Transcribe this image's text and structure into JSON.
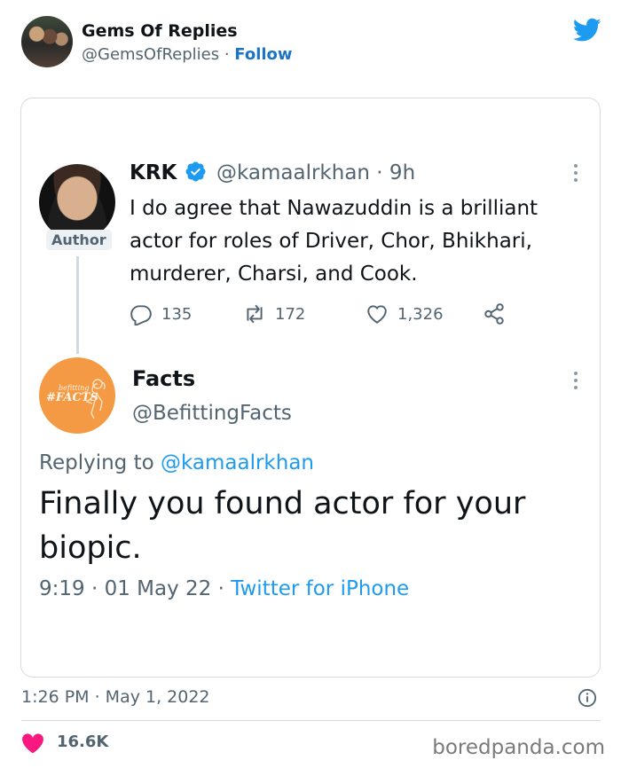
{
  "embed": {
    "author_name": "Gems Of Replies",
    "author_handle": "@GemsOfReplies",
    "separator": " · ",
    "follow_label": "Follow",
    "timestamp": "1:26 PM · May 1, 2022",
    "like_count": "16.6K",
    "brand_color": "#1d9bf0",
    "icons": [
      "twitter-bird-icon",
      "info-icon",
      "heart-icon"
    ]
  },
  "quoted": {
    "parent": {
      "name": "KRK",
      "handle_time": "@kamaalrkhan · 9h",
      "author_badge": "Author",
      "text": "I do agree that Nawazuddin is a brilliant actor for roles of Driver, Chor, Bhikhari, murderer, Charsi, and Cook.",
      "replies": "135",
      "retweets": "172",
      "likes": "1,326"
    },
    "reply": {
      "name": "Facts",
      "handle": "@BefittingFacts",
      "avatar_small_text": "befitting",
      "avatar_text": "#FACTS",
      "replying_to_label": "Replying to ",
      "replying_to_handle": "@kamaalrkhan",
      "text": "Finally you found actor for your biopic.",
      "time": "9:19 · 01 May 22 · ",
      "source": "Twitter for iPhone"
    }
  },
  "watermark": "boredpanda.com"
}
